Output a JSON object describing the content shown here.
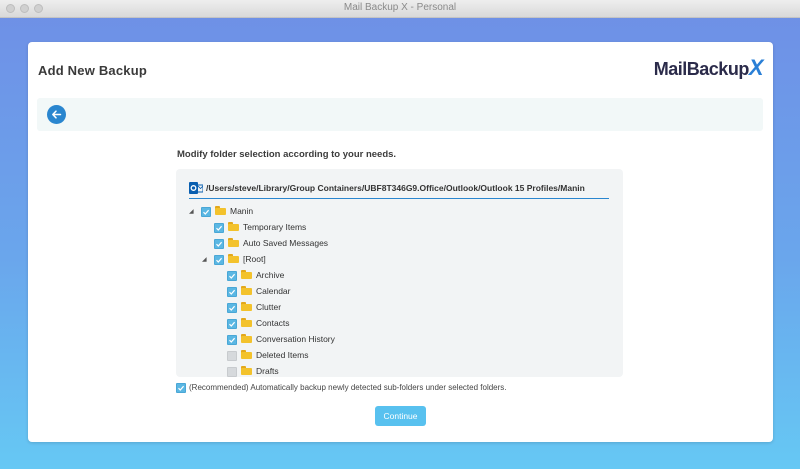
{
  "window": {
    "title": "Mail Backup X - Personal"
  },
  "header": {
    "page_title": "Add New Backup",
    "logo_text": "MailBackup",
    "logo_x": "X"
  },
  "instruction": "Modify folder selection according to your needs.",
  "path": "/Users/steve/Library/Group Containers/UBF8T346G9.Office/Outlook/Outlook 15 Profiles/Manin",
  "tree": [
    {
      "label": "Manin",
      "checked": true,
      "expanded": true,
      "level": 0
    },
    {
      "label": "Temporary Items",
      "checked": true,
      "level": 1
    },
    {
      "label": "Auto Saved Messages",
      "checked": true,
      "level": 1
    },
    {
      "label": "[Root]",
      "checked": true,
      "expanded": true,
      "level": 1
    },
    {
      "label": "Archive",
      "checked": true,
      "level": 2
    },
    {
      "label": "Calendar",
      "checked": true,
      "level": 2
    },
    {
      "label": "Clutter",
      "checked": true,
      "level": 2
    },
    {
      "label": "Contacts",
      "checked": true,
      "level": 2
    },
    {
      "label": "Conversation History",
      "checked": true,
      "level": 2
    },
    {
      "label": "Deleted Items",
      "checked": false,
      "level": 2
    },
    {
      "label": "Drafts",
      "checked": false,
      "level": 2
    }
  ],
  "recommended_option": {
    "label": "(Recommended) Automatically backup newly detected sub-folders under selected folders.",
    "checked": true
  },
  "continue_label": "Continue",
  "colors": {
    "accent": "#2a86cf",
    "checkbox": "#5bb7e3",
    "folder": "#f3c22c",
    "button": "#58c1ef"
  }
}
